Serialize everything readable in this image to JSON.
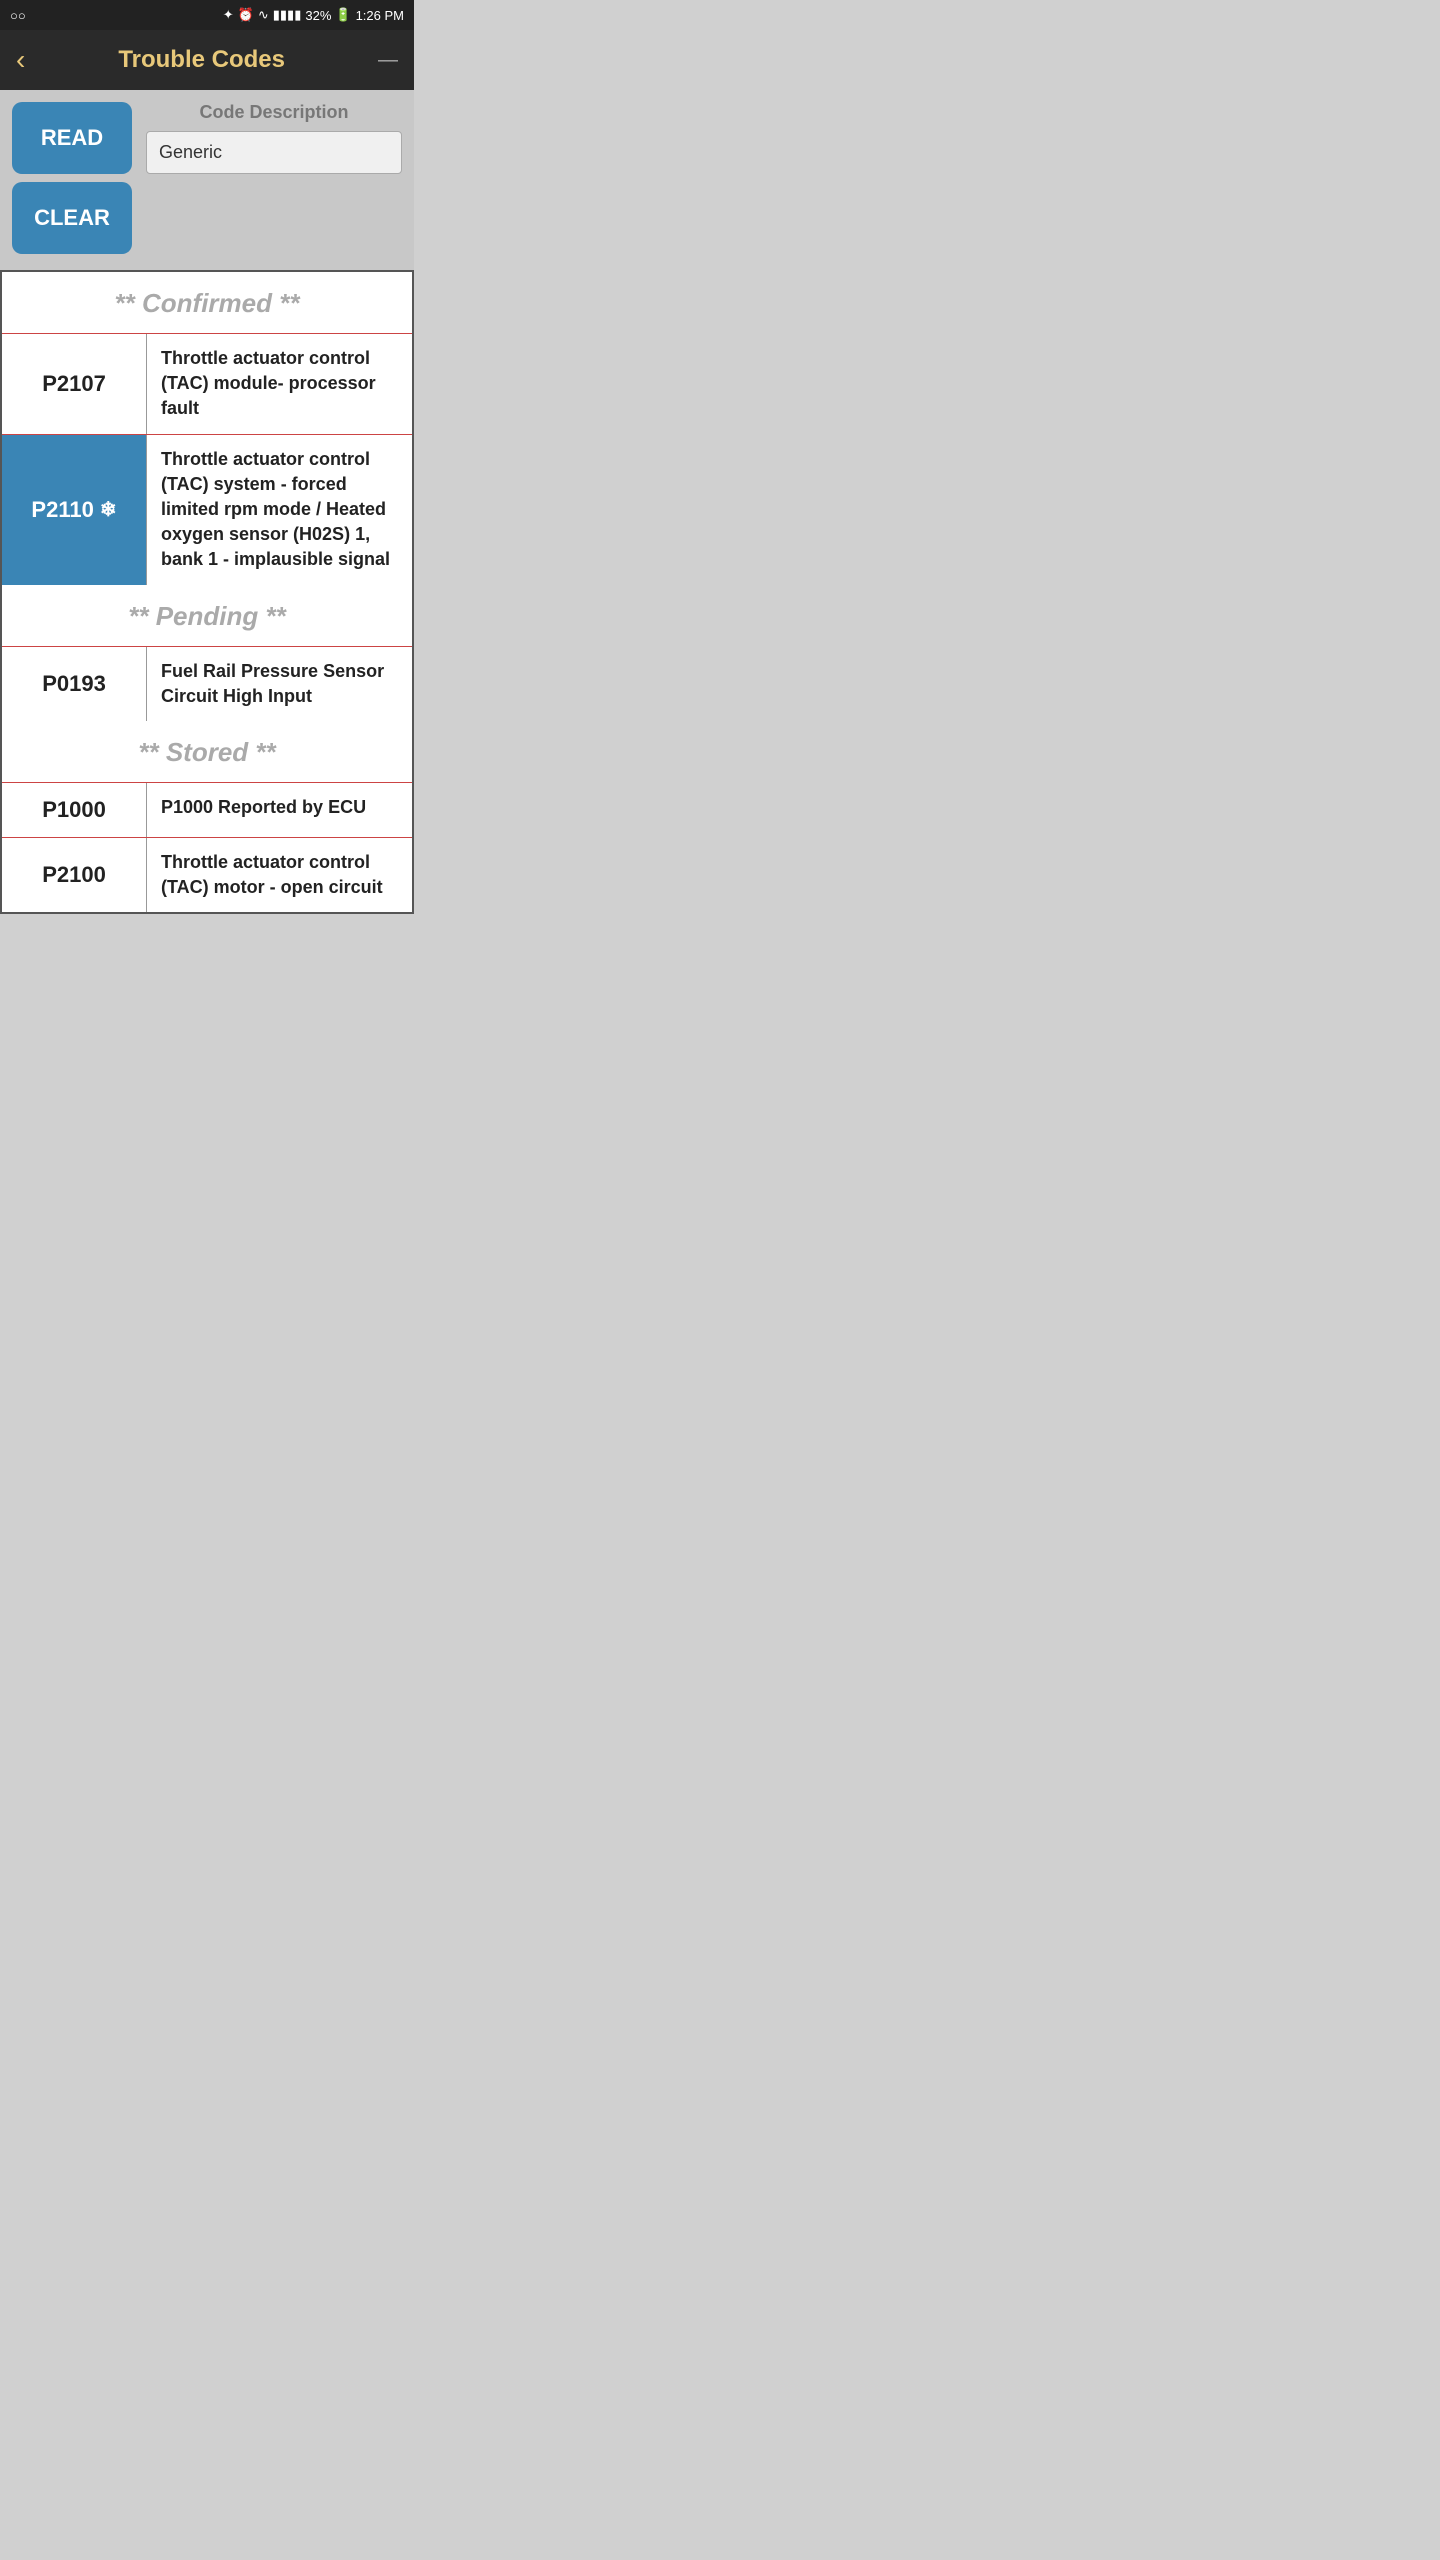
{
  "statusBar": {
    "left": "○○",
    "bluetooth": "⚙",
    "alarm": "⏰",
    "wifi": "WiFi",
    "signal": "▐▐▐▐",
    "battery": "32%",
    "time": "1:26 PM"
  },
  "header": {
    "back_icon": "‹",
    "title": "Trouble Codes",
    "menu_icon": "—"
  },
  "controls": {
    "read_label": "READ",
    "clear_label": "CLEAR",
    "code_description_label": "Code Description",
    "code_description_value": "Generic"
  },
  "sections": [
    {
      "name": "confirmed",
      "header": "** Confirmed **",
      "rows": [
        {
          "code": "P2107",
          "description": "Throttle actuator control (TAC) module- processor fault",
          "highlighted": false,
          "has_snowflake": false
        },
        {
          "code": "P2110",
          "description": "Throttle actuator control (TAC) system - forced limited rpm mode / Heated oxygen sensor (H02S) 1, bank 1 - implausible signal",
          "highlighted": true,
          "has_snowflake": true
        }
      ]
    },
    {
      "name": "pending",
      "header": "** Pending **",
      "rows": [
        {
          "code": "P0193",
          "description": "Fuel Rail Pressure Sensor Circuit High Input",
          "highlighted": false,
          "has_snowflake": false
        }
      ]
    },
    {
      "name": "stored",
      "header": "** Stored **",
      "rows": [
        {
          "code": "P1000",
          "description": "P1000 Reported by ECU",
          "highlighted": false,
          "has_snowflake": false
        },
        {
          "code": "P2100",
          "description": "Throttle actuator control (TAC) motor - open circuit",
          "highlighted": false,
          "has_snowflake": false
        }
      ]
    }
  ]
}
